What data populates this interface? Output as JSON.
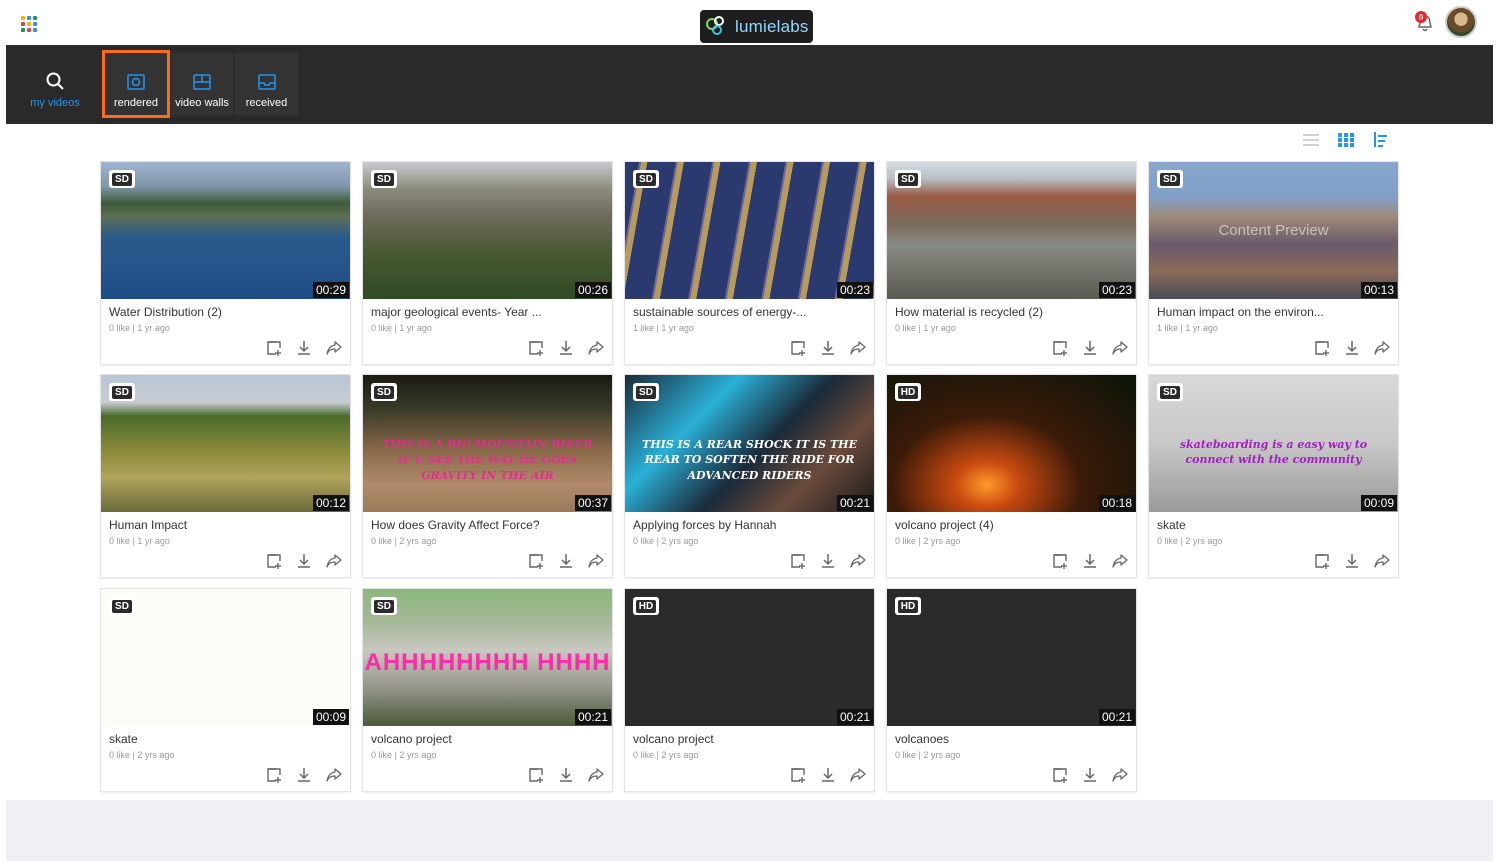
{
  "header": {
    "logo_text": "lumielabs",
    "notification_count": "0"
  },
  "nav": {
    "my_videos": "my videos",
    "rendered": "rendered",
    "video_walls": "video walls",
    "received": "received"
  },
  "colors": {
    "accent": "#2196f3",
    "selected_outline": "#ff6b1a",
    "nav_bg": "#2a2a2a"
  },
  "cards": [
    {
      "quality": "SD",
      "duration": "00:29",
      "title": "Water Distribution (2)",
      "meta": "0 like | 1 yr ago",
      "thumb": "harbor"
    },
    {
      "quality": "SD",
      "duration": "00:26",
      "title": "major geological events- Year ...",
      "meta": "0 like | 1 yr ago",
      "thumb": "ruins"
    },
    {
      "quality": "SD",
      "duration": "00:23",
      "title": "sustainable sources of energy-...",
      "meta": "1 like | 1 yr ago",
      "thumb": "solar"
    },
    {
      "quality": "SD",
      "duration": "00:23",
      "title": "How material is recycled (2)",
      "meta": "0 like | 1 yr ago",
      "thumb": "recycle"
    },
    {
      "quality": "SD",
      "duration": "00:13",
      "title": "Human impact on the environ...",
      "meta": "1 like | 1 yr ago",
      "thumb": "trash",
      "overlay": "Content Preview"
    },
    {
      "quality": "SD",
      "duration": "00:12",
      "title": "Human Impact",
      "meta": "0 like | 1 yr ago",
      "thumb": "field"
    },
    {
      "quality": "SD",
      "duration": "00:37",
      "title": "How does Gravity Affect Force?",
      "meta": "0 like | 2 yrs ago",
      "thumb": "dirt",
      "overlay": "THIS IS A BIG MOUNTAIN BIKER IF U SEE THE WAY HE GOES GRAVITY IN THE AIR"
    },
    {
      "quality": "SD",
      "duration": "00:21",
      "title": "Applying forces by Hannah",
      "meta": "0 like | 2 yrs ago",
      "thumb": "bike",
      "overlay": "THIS IS A REAR SHOCK IT IS THE REAR TO SOFTEN THE RIDE FOR ADVANCED RIDERS"
    },
    {
      "quality": "HD",
      "duration": "00:18",
      "title": "volcano project (4)",
      "meta": "0 like | 2 yrs ago",
      "thumb": "lava"
    },
    {
      "quality": "SD",
      "duration": "00:09",
      "title": "skate",
      "meta": "0 like | 2 yrs ago",
      "thumb": "skate",
      "overlay": "skateboarding is a easy way to connect with the community"
    },
    {
      "quality": "SD",
      "duration": "00:09",
      "title": "skate",
      "meta": "0 like | 2 yrs ago",
      "thumb": "white"
    },
    {
      "quality": "SD",
      "duration": "00:21",
      "title": "volcano project",
      "meta": "0 like | 2 yrs ago",
      "thumb": "ash",
      "overlay": "AHHHHHHHH HHHH"
    },
    {
      "quality": "HD",
      "duration": "00:21",
      "title": "volcano project",
      "meta": "0 like | 2 yrs ago",
      "thumb": "dark"
    },
    {
      "quality": "HD",
      "duration": "00:21",
      "title": "volcanoes",
      "meta": "0 like | 2 yrs ago",
      "thumb": "dark"
    }
  ]
}
